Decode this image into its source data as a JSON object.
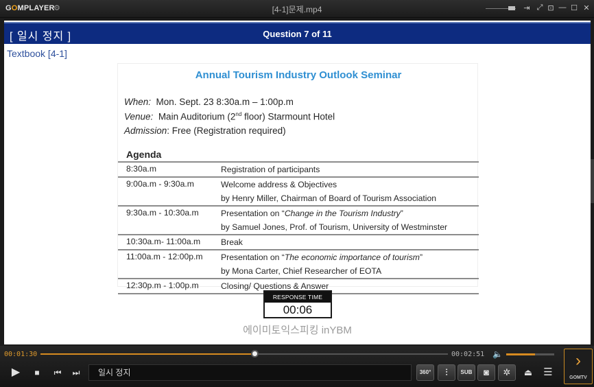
{
  "app": {
    "logo_prefix": "G",
    "logo_o": "O",
    "logo_suffix": "MPLAYER",
    "window_title": "[4-1]문제.mp4"
  },
  "video": {
    "paused_label": "[ 일시 정지 ]",
    "question_label": "Question 7 of 11",
    "textbook_label": "Textbook [4-1]",
    "slide": {
      "title": "Annual Tourism Industry Outlook Seminar",
      "when_key": "When:",
      "when_value": "Mon. Sept. 23  8:30a.m – 1:00p.m",
      "venue_key": "Venue:",
      "venue_value_a": "Main Auditorium (2",
      "venue_value_sup": "nd",
      "venue_value_b": " floor) Starmount Hotel",
      "admission_key": "Admission",
      "admission_value": ": Free (Registration required)",
      "agenda_heading": "Agenda",
      "agenda": [
        {
          "time": "8:30a.m",
          "line1": "Registration of participants",
          "line2": ""
        },
        {
          "time": "9:00a.m - 9:30a.m",
          "line1": "Welcome address & Objectives",
          "line2": "by Henry Miller, Chairman of Board of Tourism Association"
        },
        {
          "time": "9:30a.m - 10:30a.m",
          "line1_pre": "Presentation on “",
          "line1_em": "Change in the Tourism Industry",
          "line1_post": "”",
          "line2": "by Samuel Jones, Prof. of Tourism, University of Westminster"
        },
        {
          "time": "10:30a.m- 11:00a.m",
          "line1": "Break",
          "line2": ""
        },
        {
          "time": "11:00a.m - 12:00p.m",
          "line1_pre": "Presentation on “",
          "line1_em": "The economic importance of tourism",
          "line1_post": "”",
          "line2": "by Mona Carter, Chief Researcher of EOTA"
        },
        {
          "time": "12:30p.m - 1:00p.m",
          "line1": "Closing/ Questions & Answer",
          "line2": ""
        }
      ]
    },
    "response_label": "RESPONSE TIME",
    "response_time": "00:06",
    "brand": "에이미토익스피킹 inYBM"
  },
  "controls": {
    "current_time": "00:01:30",
    "total_time": "00:02:51",
    "progress_fraction": 0.526,
    "volume_fraction": 0.6,
    "status_text": "일시 정지",
    "btn_360": "360°",
    "btn_sub": "SUB",
    "gomtv_label": "GOMTV"
  },
  "icons": [
    "gear-icon",
    "minimize-icon",
    "maximize-icon",
    "close-icon",
    "play-icon",
    "stop-icon",
    "prev-icon",
    "next-icon",
    "volume-icon",
    "equalizer-icon",
    "camera-icon",
    "settings-icon",
    "eject-icon",
    "playlist-icon",
    "chevron-right-icon"
  ],
  "colors": {
    "accent": "#d88b20",
    "question_bar": "#0d2b80",
    "slide_title": "#2f8fd2"
  }
}
